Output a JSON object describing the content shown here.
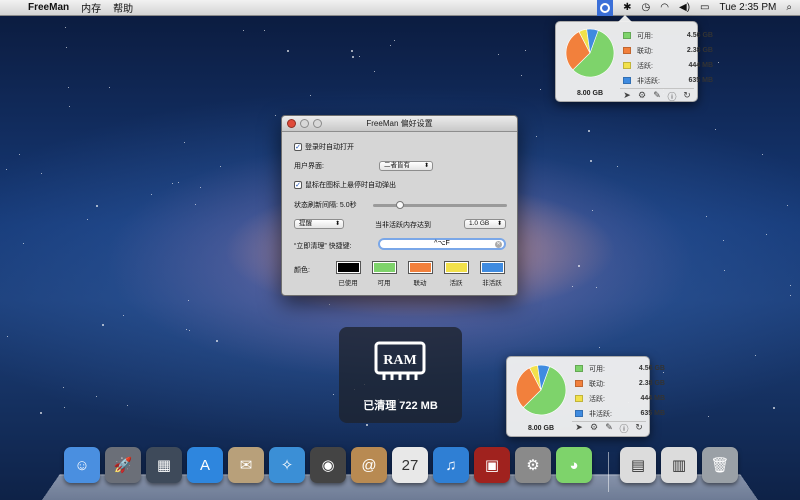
{
  "menubar": {
    "apple_glyph": "",
    "app_name": "FreeMan",
    "items": [
      "内存",
      "帮助"
    ],
    "clock": "Tue 2:35 PM",
    "status_icons": [
      "freeman-icon",
      "bluetooth-icon",
      "clock-icon",
      "wifi-icon",
      "volume-icon",
      "battery-icon",
      "spotlight-icon"
    ]
  },
  "memory": {
    "total": "8.00 GB",
    "rows": [
      {
        "name": "可用:",
        "value": "4.56 GB",
        "color": "#7ed36b"
      },
      {
        "name": "联动:",
        "value": "2.38 GB",
        "color": "#f2803c"
      },
      {
        "name": "活跃:",
        "value": "444 MB",
        "color": "#f2e14a"
      },
      {
        "name": "非活跃:",
        "value": "635 MB",
        "color": "#3f8be0"
      }
    ],
    "action_icons": [
      "location-arrow-icon",
      "gear-icon",
      "brush-icon",
      "info-icon",
      "refresh-icon"
    ]
  },
  "chart_data": {
    "type": "pie",
    "categories": [
      "可用",
      "联动",
      "活跃",
      "非活跃"
    ],
    "values": [
      4.56,
      2.38,
      0.434,
      0.62
    ],
    "colors": [
      "#7ed36b",
      "#f2803c",
      "#f2e14a",
      "#3f8be0"
    ]
  },
  "prefs": {
    "title": "FreeMan 偏好设置",
    "launch_at_login": "登录时自动打开",
    "ui_label": "用户界面:",
    "ui_value": "二者皆有",
    "hover_popup": "鼠标在图标上悬停时自动弹出",
    "refresh_label": "状态刷新间隔: 5.0秒",
    "refresh_fraction": 0.2,
    "alert_value": "提醒",
    "threshold_label": "当非活跃内存达到",
    "threshold_value": "1.0 GB",
    "hotkey_label": "“立即清理” 快捷键:",
    "hotkey_value": "^⌥F",
    "colors_label": "颜色:",
    "swatches": [
      {
        "label": "已使用",
        "color": "#000000"
      },
      {
        "label": "可用",
        "color": "#7ed36b"
      },
      {
        "label": "联动",
        "color": "#f2803c"
      },
      {
        "label": "活跃",
        "color": "#f2e14a"
      },
      {
        "label": "非活跃",
        "color": "#3f8be0"
      }
    ]
  },
  "hud": {
    "chip_label": "RAM",
    "message": "已清理 722 MB"
  },
  "dock": {
    "items": [
      {
        "name": "finder",
        "glyph": "☺",
        "color": "#4a8fe0"
      },
      {
        "name": "launchpad",
        "glyph": "🚀",
        "color": "#6b6f78"
      },
      {
        "name": "mission-control",
        "glyph": "▦",
        "color": "#3e4a5a"
      },
      {
        "name": "app-store",
        "glyph": "A",
        "color": "#2e86de"
      },
      {
        "name": "mail",
        "glyph": "✉",
        "color": "#b8a07a"
      },
      {
        "name": "safari",
        "glyph": "✧",
        "color": "#3b8fd6"
      },
      {
        "name": "facetime",
        "glyph": "◉",
        "color": "#444"
      },
      {
        "name": "contacts",
        "glyph": "@",
        "color": "#b88a52"
      },
      {
        "name": "calendar",
        "glyph": "27",
        "color": "#e8e8e8"
      },
      {
        "name": "itunes",
        "glyph": "♫",
        "color": "#2f7fd4"
      },
      {
        "name": "photo-booth",
        "glyph": "▣",
        "color": "#a0221e"
      },
      {
        "name": "system-preferences",
        "glyph": "⚙",
        "color": "#8a8a8a"
      },
      {
        "name": "freeman",
        "glyph": "◕",
        "color": "#7ed36b"
      },
      {
        "name": "documents",
        "glyph": "▤",
        "color": "#dcdcdc"
      },
      {
        "name": "downloads",
        "glyph": "▥",
        "color": "#dcdcdc"
      },
      {
        "name": "trash",
        "glyph": "🗑",
        "color": "#9aa0a6"
      }
    ]
  }
}
